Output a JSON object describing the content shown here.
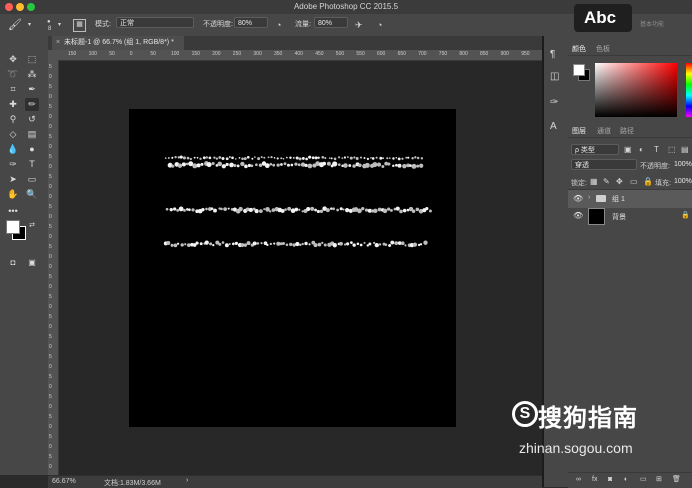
{
  "window": {
    "title": "Adobe Photoshop CC 2015.5"
  },
  "options_bar": {
    "brush_size": "8",
    "mode_label": "模式:",
    "mode_value": "正常",
    "opacity_label": "不透明度:",
    "opacity_value": "80%",
    "flow_label": "流量:",
    "flow_value": "80%"
  },
  "workspace_button": {
    "label": "Abc",
    "hint": "基本功能"
  },
  "document": {
    "tab_label": "未标题-1 @ 66.7% (组 1, RGB/8*) *"
  },
  "ruler": {
    "h_ticks": [
      "150",
      "100",
      "50",
      "0",
      "50",
      "100",
      "150",
      "200",
      "250",
      "300",
      "350",
      "400",
      "450",
      "500",
      "550",
      "600",
      "650",
      "700",
      "750",
      "800",
      "850",
      "900",
      "950"
    ],
    "v_ticks": [
      "5",
      "0",
      "5",
      "0",
      "5",
      "0",
      "0",
      "5",
      "0",
      "5",
      "0",
      "5",
      "0",
      "0",
      "5",
      "0",
      "5",
      "0",
      "5",
      "0",
      "0",
      "5",
      "0",
      "5",
      "0",
      "5",
      "0",
      "5",
      "0",
      "5",
      "0",
      "5",
      "0",
      "5",
      "0",
      "5",
      "0",
      "5",
      "0",
      "5",
      "0"
    ]
  },
  "status_bar": {
    "zoom": "66.67%",
    "doc_info": "文档:1.83M/3.66M"
  },
  "color_panel": {
    "tabs": [
      "颜色",
      "色板"
    ]
  },
  "layers_panel": {
    "tabs": [
      "图层",
      "通道",
      "路径"
    ],
    "filter_label": "ρ 类型",
    "blend_mode": "穿透",
    "opacity_label": "不透明度:",
    "opacity_value": "100%",
    "lock_label": "锁定:",
    "fill_label": "填充:",
    "fill_value": "100%",
    "layers": [
      {
        "name": "组 1",
        "type": "group"
      },
      {
        "name": "背景",
        "type": "background"
      }
    ]
  },
  "watermark": {
    "brand": "搜狗指南",
    "url": "zhinan.sogou.com"
  }
}
